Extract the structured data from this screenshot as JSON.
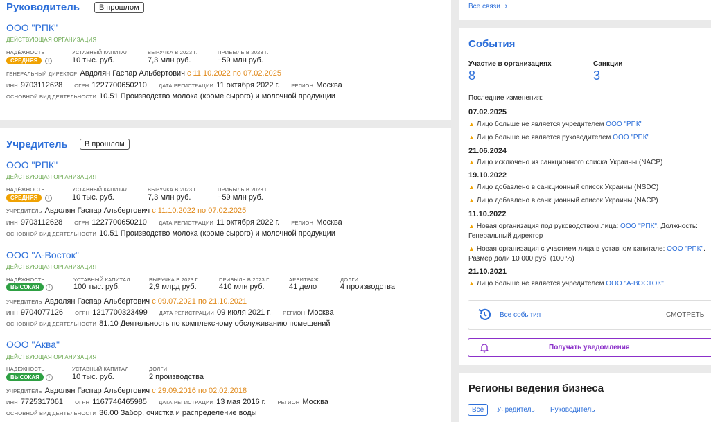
{
  "manager": {
    "title": "Руководитель",
    "badge": "В прошлом",
    "org": {
      "name": "ООО \"РПК\"",
      "status": "ДЕЙСТВУЮЩАЯ ОРГАНИЗАЦИЯ",
      "reliability_label": "НАДЁЖНОСТЬ",
      "reliability": "СРЕДНЯЯ",
      "capital_label": "УСТАВНЫЙ КАПИТАЛ",
      "capital": "10 тыс. руб.",
      "revenue_label": "ВЫРУЧКА В 2023 Г.",
      "revenue": "7,3 млн руб.",
      "profit_label": "ПРИБЫЛЬ В 2023 Г.",
      "profit": "−59 млн руб.",
      "role_label": "ГЕНЕРАЛЬНЫЙ ДИРЕКТОР",
      "person": "Авдолян Гаспар Альбертович",
      "period": "с 11.10.2022 по 07.02.2025",
      "inn_label": "ИНН",
      "inn": "9703112628",
      "ogrn_label": "ОГРН",
      "ogrn": "1227700650210",
      "regdate_label": "ДАТА РЕГИСТРАЦИИ",
      "regdate": "11 октября 2022 г.",
      "region_label": "РЕГИОН",
      "region": "Москва",
      "okved_label": "ОСНОВНОЙ ВИД ДЕЯТЕЛЬНОСТИ",
      "okved": "10.51 Производство молока (кроме сырого) и молочной продукции"
    }
  },
  "founder": {
    "title": "Учредитель",
    "badge": "В прошлом",
    "orgs": [
      {
        "name": "ООО \"РПК\"",
        "status": "ДЕЙСТВУЮЩАЯ ОРГАНИЗАЦИЯ",
        "reliability_label": "НАДЁЖНОСТЬ",
        "reliability": "СРЕДНЯЯ",
        "capital_label": "УСТАВНЫЙ КАПИТАЛ",
        "capital": "10 тыс. руб.",
        "revenue_label": "ВЫРУЧКА В 2023 Г.",
        "revenue": "7,3 млн руб.",
        "profit_label": "ПРИБЫЛЬ В 2023 Г.",
        "profit": "−59 млн руб.",
        "role_label": "УЧРЕДИТЕЛЬ",
        "person": "Авдолян Гаспар Альбертович",
        "period": "с 11.10.2022 по 07.02.2025",
        "inn_label": "ИНН",
        "inn": "9703112628",
        "ogrn_label": "ОГРН",
        "ogrn": "1227700650210",
        "regdate_label": "ДАТА РЕГИСТРАЦИИ",
        "regdate": "11 октября 2022 г.",
        "region_label": "РЕГИОН",
        "region": "Москва",
        "okved_label": "ОСНОВНОЙ ВИД ДЕЯТЕЛЬНОСТИ",
        "okved": "10.51 Производство молока (кроме сырого) и молочной продукции"
      },
      {
        "name": "ООО \"А-Восток\"",
        "status": "ДЕЙСТВУЮЩАЯ ОРГАНИЗАЦИЯ",
        "reliability_label": "НАДЁЖНОСТЬ",
        "reliability": "ВЫСОКАЯ",
        "capital_label": "УСТАВНЫЙ КАПИТАЛ",
        "capital": "100 тыс. руб.",
        "revenue_label": "ВЫРУЧКА В 2023 Г.",
        "revenue": "2,9 млрд руб.",
        "profit_label": "ПРИБЫЛЬ В 2023 Г.",
        "profit": "410 млн руб.",
        "arb_label": "АРБИТРАЖ",
        "arb": "41 дело",
        "debt_label": "ДОЛГИ",
        "debt": "4 производства",
        "role_label": "УЧРЕДИТЕЛЬ",
        "person": "Авдолян Гаспар Альбертович",
        "period": "с 09.07.2021 по 21.10.2021",
        "inn_label": "ИНН",
        "inn": "9704077126",
        "ogrn_label": "ОГРН",
        "ogrn": "1217700323499",
        "regdate_label": "ДАТА РЕГИСТРАЦИИ",
        "regdate": "09 июля 2021 г.",
        "region_label": "РЕГИОН",
        "region": "Москва",
        "okved_label": "ОСНОВНОЙ ВИД ДЕЯТЕЛЬНОСТИ",
        "okved": "81.10 Деятельность по комплексному обслуживанию помещений"
      },
      {
        "name": "ООО \"Аква\"",
        "status": "ДЕЙСТВУЮЩАЯ ОРГАНИЗАЦИЯ",
        "reliability_label": "НАДЁЖНОСТЬ",
        "reliability": "ВЫСОКАЯ",
        "capital_label": "УСТАВНЫЙ КАПИТАЛ",
        "capital": "10 тыс. руб.",
        "debt_label": "ДОЛГИ",
        "debt": "2 производства",
        "role_label": "УЧРЕДИТЕЛЬ",
        "person": "Авдолян Гаспар Альбертович",
        "period": "с 29.09.2016 по 02.02.2018",
        "inn_label": "ИНН",
        "inn": "7725317061",
        "ogrn_label": "ОГРН",
        "ogrn": "1167746465985",
        "regdate_label": "ДАТА РЕГИСТРАЦИИ",
        "regdate": "13 мая 2016 г.",
        "region_label": "РЕГИОН",
        "region": "Москва",
        "okved_label": "ОСНОВНОЙ ВИД ДЕЯТЕЛЬНОСТИ",
        "okved": "36.00 Забор, очистка и распределение воды"
      }
    ]
  },
  "links": {
    "all_links": "Все связи"
  },
  "events": {
    "title": "События",
    "orgs_label": "Участие в организациях",
    "orgs_count": "8",
    "sanctions_label": "Санкции",
    "sanctions_count": "3",
    "recent_label": "Последние изменения:",
    "groups": [
      {
        "date": "07.02.2025",
        "items": [
          {
            "text": "Лицо больше не является учредителем ",
            "link": "ООО \"РПК\"",
            "tail": ""
          },
          {
            "text": "Лицо больше не является руководителем ",
            "link": "ООО \"РПК\"",
            "tail": ""
          }
        ]
      },
      {
        "date": "21.06.2024",
        "items": [
          {
            "text": "Лицо исключено из санкционного списка Украины (NACP)",
            "link": "",
            "tail": ""
          }
        ]
      },
      {
        "date": "19.10.2022",
        "items": [
          {
            "text": "Лицо добавлено в санкционный список Украины (NSDC)",
            "link": "",
            "tail": ""
          },
          {
            "text": "Лицо добавлено в санкционный список Украины (NACP)",
            "link": "",
            "tail": ""
          }
        ]
      },
      {
        "date": "11.10.2022",
        "items": [
          {
            "text": "Новая организация под руководством лица: ",
            "link": "ООО \"РПК\"",
            "tail": ". Должность: Генеральный директор"
          },
          {
            "text": "Новая организация с участием лица в уставном капитале: ",
            "link": "ООО \"РПК\"",
            "tail": ". Размер доли 10 000 руб. (100 %)"
          }
        ]
      },
      {
        "date": "21.10.2021",
        "items": [
          {
            "text": "Лицо больше не является учредителем ",
            "link": "ООО \"А-ВОСТОК\"",
            "tail": ""
          }
        ]
      }
    ],
    "all_events": "Все события",
    "view": "СМОТРЕТЬ",
    "notify": "Получать уведомления"
  },
  "regions": {
    "title": "Регионы ведения бизнеса",
    "tabs": [
      "Все",
      "Учредитель",
      "Руководитель"
    ]
  },
  "colors": {
    "accent": "#2d6fd9",
    "warn": "#f0a202",
    "high": "#2ea043",
    "notify": "#8b2fc9"
  }
}
